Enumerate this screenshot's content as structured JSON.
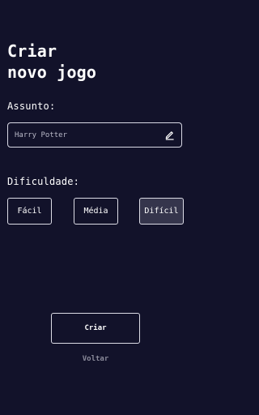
{
  "page": {
    "title_line1": "Criar",
    "title_line2": "novo jogo"
  },
  "subject": {
    "label": "Assunto:",
    "value": "Harry Potter",
    "icon": "pencil-icon"
  },
  "difficulty": {
    "label": "Dificuldade:",
    "options": [
      "Fácil",
      "Média",
      "Difícil"
    ],
    "selected": "Difícil"
  },
  "actions": {
    "create_label": "Criar",
    "back_label": "Voltar"
  },
  "colors": {
    "background": "#12122a",
    "selected_option": "#35354c",
    "border": "#dcdce6"
  }
}
